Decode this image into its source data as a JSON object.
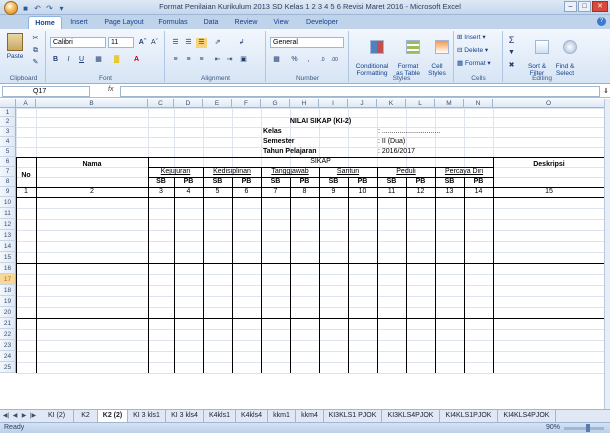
{
  "window": {
    "title": "Format Penilaian Kurikulum 2013 SD Kelas 1 2 3 4 5 6 Revisi Maret 2016 - Microsoft Excel"
  },
  "tabs": [
    "Home",
    "Insert",
    "Page Layout",
    "Formulas",
    "Data",
    "Review",
    "View",
    "Developer"
  ],
  "ribbon": {
    "clipboard": {
      "paste": "Paste",
      "label": "Clipboard"
    },
    "font": {
      "name": "Calibri",
      "size": "11",
      "label": "Font"
    },
    "alignment": {
      "label": "Alignment"
    },
    "number": {
      "format": "General",
      "label": "Number"
    },
    "styles": {
      "conditional": "Conditional\nFormatting",
      "format_table": "Format\nas Table",
      "cell_styles": "Cell\nStyles",
      "label": "Styles"
    },
    "cells": {
      "insert": "Insert",
      "delete": "Delete",
      "format": "Format",
      "label": "Cells"
    },
    "editing": {
      "sort": "Sort &\nFilter",
      "find": "Find &\nSelect",
      "label": "Editing"
    }
  },
  "formula_bar": {
    "name_box": "Q17",
    "fx": "fx",
    "formula": ""
  },
  "columns": [
    "A",
    "B",
    "C",
    "D",
    "E",
    "F",
    "G",
    "H",
    "I",
    "J",
    "K",
    "L",
    "M",
    "N",
    "O"
  ],
  "rows": [
    "1",
    "2",
    "3",
    "4",
    "5",
    "6",
    "7",
    "8",
    "9",
    "10",
    "11",
    "12",
    "13",
    "14",
    "15",
    "16",
    "17",
    "18",
    "19",
    "20",
    "21",
    "22",
    "23",
    "24",
    "25"
  ],
  "sheet": {
    "title": "NILAI SIKAP (KI-2)",
    "kelas_label": "Kelas",
    "kelas_value": ": ..............................",
    "semester_label": "Semester",
    "semester_value": ": II (Dua)",
    "tahun_label": "Tahun Pelajaran",
    "tahun_value": ": 2016/2017",
    "header_no": "No",
    "header_nama": "Nama",
    "header_sikap": "SIKAP",
    "header_deskripsi": "Deskripsi",
    "groups": [
      "Kejujuran",
      "Kedisiplinan",
      "Tanggjawab",
      "Santun",
      "Peduli",
      "Percaya Diri"
    ],
    "sb": "SB",
    "pb": "PB",
    "numbers": [
      "1",
      "2",
      "3",
      "4",
      "5",
      "6",
      "7",
      "8",
      "9",
      "10",
      "11",
      "12",
      "13",
      "14",
      "15"
    ]
  },
  "sheet_tabs": [
    "KI (2)",
    "K2",
    "K2 (2)",
    "KI 3 kls1",
    "KI 3 kls4",
    "K4kls1",
    "K4kls4",
    "kkm1",
    "kkm4",
    "KI3KLS1 PJOK",
    "KI3KLS4PJOK",
    "KI4KLS1PJOK",
    "KI4KLS4PJOK"
  ],
  "active_sheet": "K2 (2)",
  "status": {
    "ready": "Ready",
    "zoom": "90%"
  }
}
